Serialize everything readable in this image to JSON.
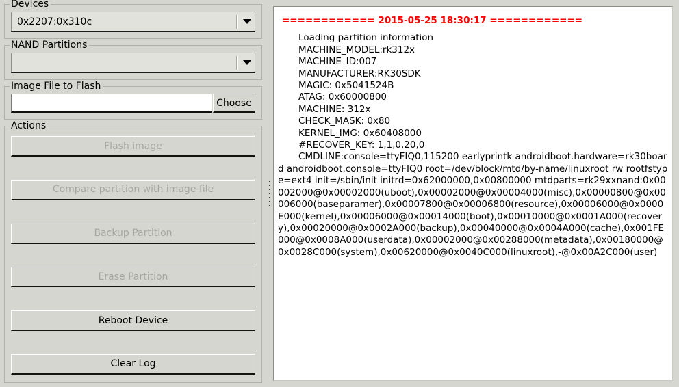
{
  "left_panel": {
    "devices": {
      "title": "Devices",
      "selected": "0x2207:0x310c",
      "arrow_icon": "chevron-down-icon"
    },
    "nand_partitions": {
      "title": "NAND Partitions",
      "selected": "",
      "arrow_icon": "chevron-down-icon"
    },
    "image_file": {
      "title": "Image File to Flash",
      "path_value": "",
      "path_placeholder": "",
      "choose_label": "Choose"
    },
    "actions": {
      "title": "Actions",
      "buttons": [
        {
          "label": "Flash image",
          "enabled": false
        },
        {
          "label": "Compare partition with image file",
          "enabled": false
        },
        {
          "label": "Backup Partition",
          "enabled": false
        },
        {
          "label": "Erase Partition",
          "enabled": false
        },
        {
          "label": "Reboot Device",
          "enabled": true
        },
        {
          "label": "Clear Log",
          "enabled": true
        }
      ]
    }
  },
  "splitter": {
    "name": "pane-splitter",
    "handle_dots": 7
  },
  "log": {
    "header": "============ 2015-05-25 18:30:17 ============",
    "header_color": "#fe0000",
    "body": "       Loading partition information\n       MACHINE_MODEL:rk312x\n       MACHINE_ID:007\n       MANUFACTURER:RK30SDK\n       MAGIC: 0x5041524B\n       ATAG: 0x60000800\n       MACHINE: 312x\n       CHECK_MASK: 0x80\n       KERNEL_IMG: 0x60408000\n       #RECOVER_KEY: 1,1,0,20,0\n       CMDLINE:console=ttyFIQ0,115200 earlyprintk androidboot.hardware=rk30board androidboot.console=ttyFIQ0 root=/dev/block/mtd/by-name/linuxroot rw rootfstype=ext4 init=/sbin/init initrd=0x62000000,0x00800000 mtdparts=rk29xxnand:0x00002000@0x00002000(uboot),0x00002000@0x00004000(misc),0x00000800@0x00006000(baseparamer),0x00007800@0x00006800(resource),0x00006000@0x0000E000(kernel),0x00006000@0x00014000(boot),0x00010000@0x0001A000(recovery),0x00020000@0x0002A000(backup),0x00040000@0x0004A000(cache),0x001FE000@0x0008A000(userdata),0x00002000@0x00288000(metadata),0x00180000@0x0028C000(system),0x00620000@0x0040C000(linuxroot),-@0x00A2C000(user)"
  }
}
